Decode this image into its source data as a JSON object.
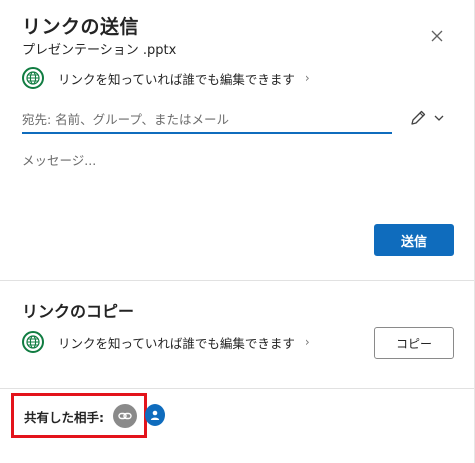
{
  "dialog": {
    "title": "リンクの送信",
    "file_name": "プレゼンテーション .pptx",
    "close_icon": "close-icon"
  },
  "send_section": {
    "permission_text": "リンクを知っていれば誰でも編集できます",
    "permission_icon": "globe-icon",
    "to_placeholder": "宛先: 名前、グループ、またはメール",
    "to_value": "",
    "message_placeholder": "メッセージ...",
    "message_value": "",
    "send_label": "送信"
  },
  "copy_section": {
    "title": "リンクのコピー",
    "permission_text": "リンクを知っていれば誰でも編集できます",
    "copy_label": "コピー"
  },
  "shared_with": {
    "label": "共有した相手:",
    "items": [
      "link-icon",
      "person-icon"
    ]
  },
  "colors": {
    "accent": "#0f6cbd",
    "globe": "#107c41",
    "highlight": "#e3131b",
    "link_avatar": "#8a8a8a"
  }
}
